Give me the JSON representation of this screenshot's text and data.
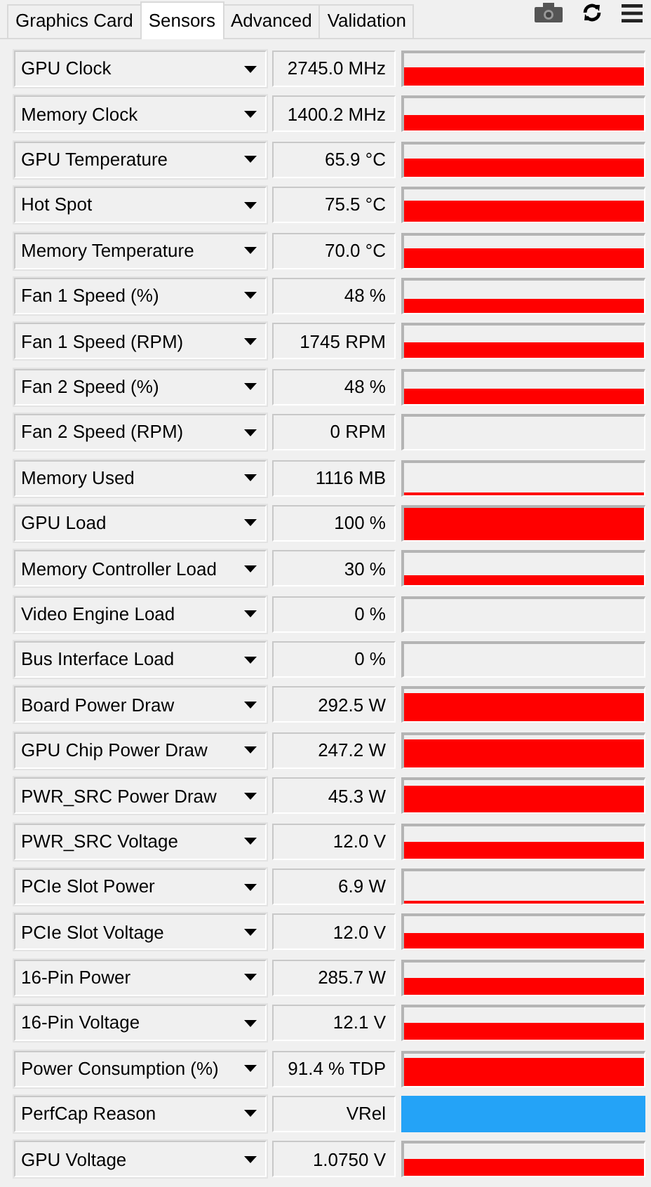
{
  "tabs": [
    {
      "label": "Graphics Card",
      "selected": false
    },
    {
      "label": "Sensors",
      "selected": true
    },
    {
      "label": "Advanced",
      "selected": false
    },
    {
      "label": "Validation",
      "selected": false
    }
  ],
  "sensors": [
    {
      "name": "GPU Clock",
      "value": "2745.0 MHz",
      "kind": "graph"
    },
    {
      "name": "Memory Clock",
      "value": "1400.2 MHz",
      "kind": "graph"
    },
    {
      "name": "GPU Temperature",
      "value": "65.9 °C",
      "kind": "graph"
    },
    {
      "name": "Hot Spot",
      "value": "75.5 °C",
      "kind": "graph"
    },
    {
      "name": "Memory Temperature",
      "value": "70.0 °C",
      "kind": "graph"
    },
    {
      "name": "Fan 1 Speed (%)",
      "value": "48 %",
      "kind": "graph"
    },
    {
      "name": "Fan 1 Speed (RPM)",
      "value": "1745 RPM",
      "kind": "graph"
    },
    {
      "name": "Fan 2 Speed (%)",
      "value": "48 %",
      "kind": "graph"
    },
    {
      "name": "Fan 2 Speed (RPM)",
      "value": "0 RPM",
      "kind": "graph"
    },
    {
      "name": "Memory Used",
      "value": "1116 MB",
      "kind": "graph"
    },
    {
      "name": "GPU Load",
      "value": "100 %",
      "kind": "graph"
    },
    {
      "name": "Memory Controller Load",
      "value": "30 %",
      "kind": "graph"
    },
    {
      "name": "Video Engine Load",
      "value": "0 %",
      "kind": "graph"
    },
    {
      "name": "Bus Interface Load",
      "value": "0 %",
      "kind": "graph"
    },
    {
      "name": "Board Power Draw",
      "value": "292.5 W",
      "kind": "graph"
    },
    {
      "name": "GPU Chip Power Draw",
      "value": "247.2 W",
      "kind": "graph"
    },
    {
      "name": "PWR_SRC Power Draw",
      "value": "45.3 W",
      "kind": "graph"
    },
    {
      "name": "PWR_SRC Voltage",
      "value": "12.0 V",
      "kind": "graph"
    },
    {
      "name": "PCIe Slot Power",
      "value": "6.9 W",
      "kind": "graph"
    },
    {
      "name": "PCIe Slot Voltage",
      "value": "12.0 V",
      "kind": "graph"
    },
    {
      "name": "16-Pin Power",
      "value": "285.7 W",
      "kind": "graph"
    },
    {
      "name": "16-Pin Voltage",
      "value": "12.1 V",
      "kind": "graph"
    },
    {
      "name": "Power Consumption (%)",
      "value": "91.4 % TDP",
      "kind": "graph"
    },
    {
      "name": "PerfCap Reason",
      "value": "VRel",
      "kind": "status"
    },
    {
      "name": "GPU Voltage",
      "value": "1.0750 V",
      "kind": "graph"
    }
  ]
}
